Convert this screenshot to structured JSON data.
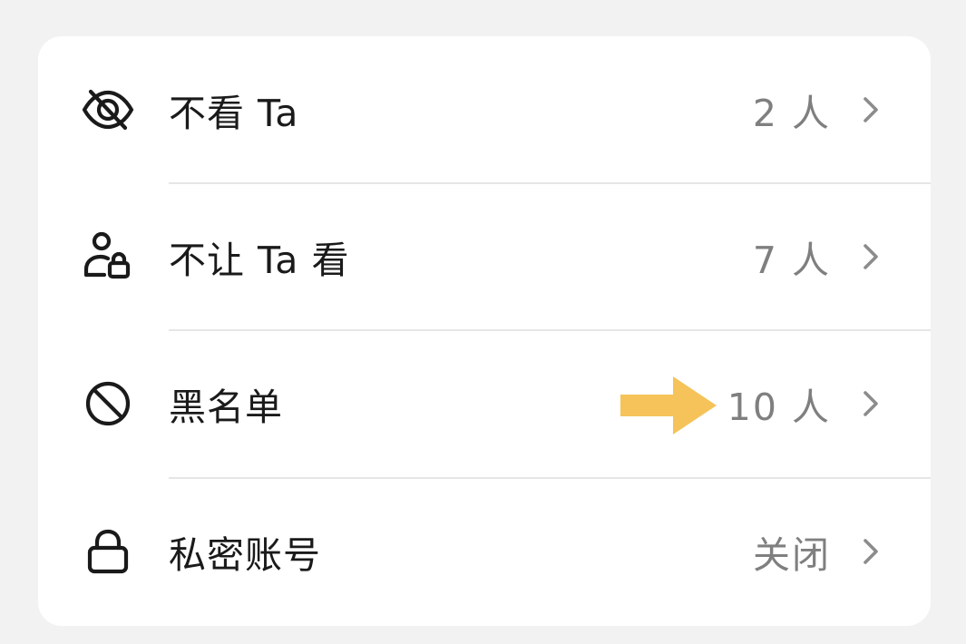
{
  "accent_color": "#f5c35a",
  "rows": [
    {
      "icon": "eye-off-icon",
      "label": "不看 Ta",
      "value": "2 人"
    },
    {
      "icon": "user-lock-icon",
      "label": "不让 Ta 看",
      "value": "7 人"
    },
    {
      "icon": "block-icon",
      "label": "黑名单",
      "value": "10 人"
    },
    {
      "icon": "lock-icon",
      "label": "私密账号",
      "value": "关闭"
    }
  ]
}
